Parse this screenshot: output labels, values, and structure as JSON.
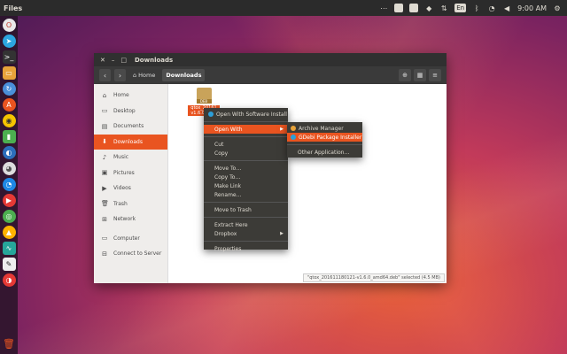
{
  "panel": {
    "app_title": "Files",
    "clock": "9:00 AM",
    "keyboard": "En"
  },
  "window": {
    "title": "Downloads",
    "breadcrumbs": [
      "Home",
      "Downloads"
    ]
  },
  "sidebar": {
    "items": [
      {
        "label": "Home",
        "icon": "home-icon",
        "glyph": "⌂"
      },
      {
        "label": "Desktop",
        "icon": "desktop-icon",
        "glyph": "▭"
      },
      {
        "label": "Documents",
        "icon": "documents-icon",
        "glyph": "▤"
      },
      {
        "label": "Downloads",
        "icon": "downloads-icon",
        "glyph": "⬇"
      },
      {
        "label": "Music",
        "icon": "music-icon",
        "glyph": "♪"
      },
      {
        "label": "Pictures",
        "icon": "pictures-icon",
        "glyph": "▣"
      },
      {
        "label": "Videos",
        "icon": "videos-icon",
        "glyph": "▶"
      },
      {
        "label": "Trash",
        "icon": "trash-icon",
        "glyph": "🗑"
      },
      {
        "label": "Network",
        "icon": "network-icon",
        "glyph": "⊞"
      },
      {
        "label": "Computer",
        "icon": "computer-icon",
        "glyph": "▭"
      },
      {
        "label": "Connect to Server",
        "icon": "server-icon",
        "glyph": "⊟"
      }
    ]
  },
  "file": {
    "type_label": "DEB",
    "name_line1": "qtox_20161",
    "name_line2": "v1.6.0_amd"
  },
  "status": "\"qtox_201611180121-v1.6.0_amd64.deb\" selected (4.5 MB)",
  "context_menu": {
    "items": [
      "Open With Software Install",
      "Open With",
      "Cut",
      "Copy",
      "Move To…",
      "Copy To…",
      "Make Link",
      "Rename…",
      "Move to Trash",
      "Extract Here",
      "Dropbox",
      "Properties"
    ]
  },
  "submenu": {
    "items": [
      "Archive Manager",
      "GDebi Package Installer",
      "Other Application…"
    ]
  },
  "colors": {
    "accent": "#e95420",
    "menu_bg": "#3c3b37",
    "panel_bg": "#2b2b2b"
  }
}
